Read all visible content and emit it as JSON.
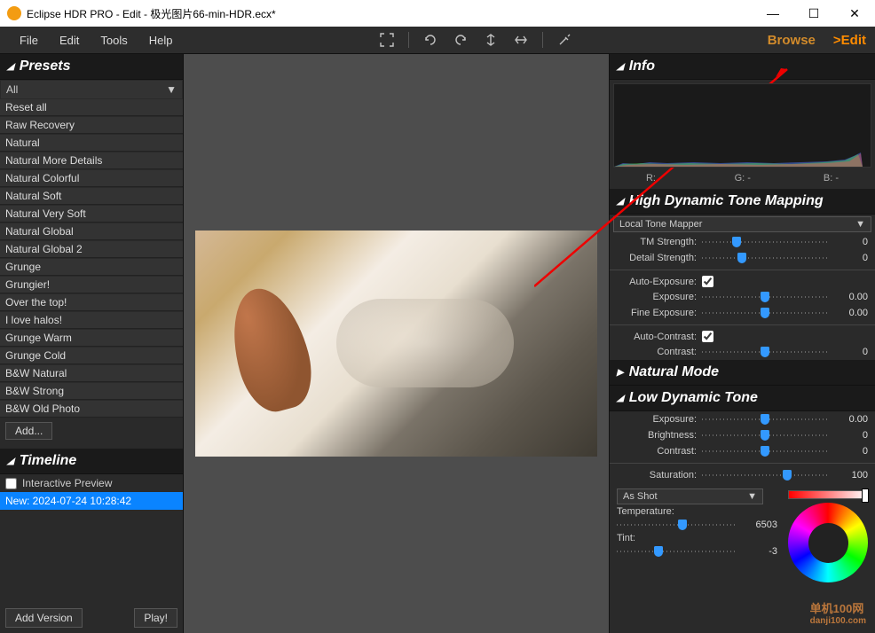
{
  "window": {
    "title": "Eclipse HDR PRO - Edit - 极光图片66-min-HDR.ecx*"
  },
  "menu": {
    "file": "File",
    "edit": "Edit",
    "tools": "Tools",
    "help": "Help"
  },
  "modes": {
    "browse": "Browse",
    "edit": ">Edit"
  },
  "panels": {
    "presets": "Presets",
    "timeline": "Timeline",
    "info": "Info",
    "hdtm": "High Dynamic Tone Mapping",
    "natural": "Natural Mode",
    "ldt": "Low Dynamic Tone"
  },
  "preset_filter": "All",
  "presets": [
    "Reset all",
    "Raw Recovery",
    "Natural",
    "Natural More Details",
    "Natural Colorful",
    "Natural Soft",
    "Natural Very Soft",
    "Natural Global",
    "Natural Global 2",
    "Grunge",
    "Grungier!",
    "Over the top!",
    "I love halos!",
    "Grunge Warm",
    "Grunge Cold",
    "B&W Natural",
    "B&W Strong",
    "B&W Old Photo"
  ],
  "add_label": "Add...",
  "timeline": {
    "preview": "Interactive Preview",
    "entry": "New: 2024-07-24 10:28:42",
    "add_version": "Add Version",
    "play": "Play!"
  },
  "rgb": {
    "r": "R: -",
    "g": "G: -",
    "b": "B: -"
  },
  "tonemap": {
    "mode_label": "Local Tone Mapper",
    "tm_strength_lbl": "TM Strength:",
    "tm_strength_val": "0",
    "detail_lbl": "Detail Strength:",
    "detail_val": "0",
    "autoexp_lbl": "Auto-Exposure:",
    "exposure_lbl": "Exposure:",
    "exposure_val": "0.00",
    "fine_lbl": "Fine Exposure:",
    "fine_val": "0.00",
    "autocon_lbl": "Auto-Contrast:",
    "contrast_lbl": "Contrast:",
    "contrast_val": "0"
  },
  "ldt": {
    "exposure_lbl": "Exposure:",
    "exposure_val": "0.00",
    "brightness_lbl": "Brightness:",
    "brightness_val": "0",
    "contrast_lbl": "Contrast:",
    "contrast_val": "0",
    "saturation_lbl": "Saturation:",
    "saturation_val": "100"
  },
  "wb": {
    "preset": "As Shot",
    "temp_lbl": "Temperature:",
    "temp_val": "6503",
    "tint_lbl": "Tint:",
    "tint_val": "-3"
  },
  "watermark": {
    "line1": "单机100网",
    "line2": "danji100.com"
  }
}
